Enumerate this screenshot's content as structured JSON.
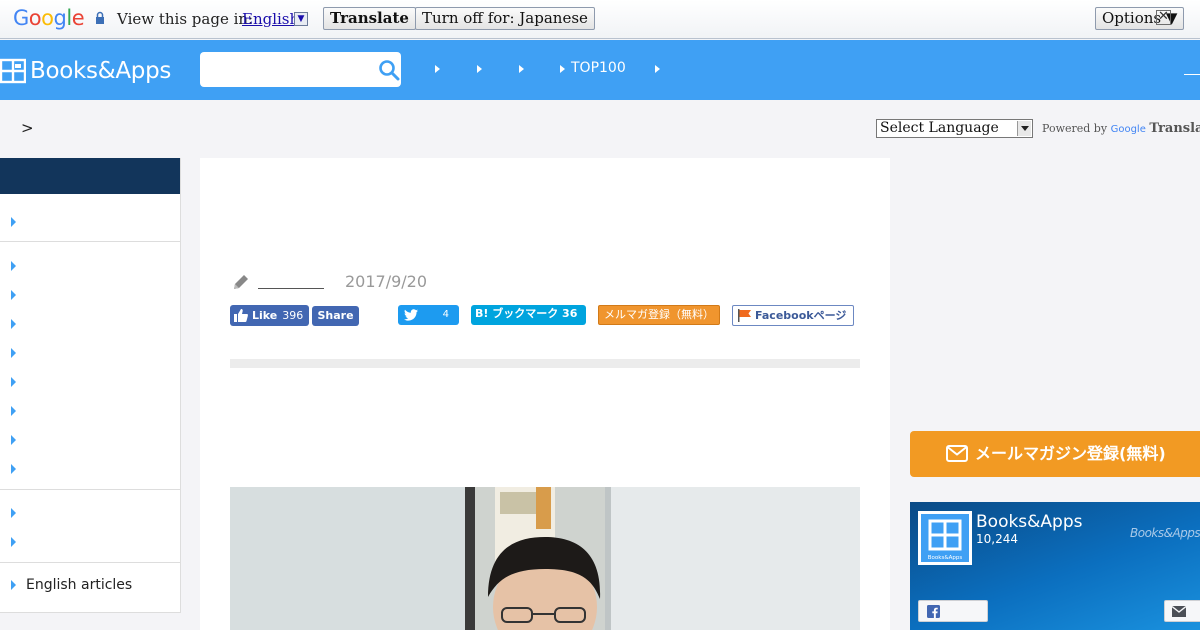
{
  "translate_bar": {
    "logo": "Google",
    "view_text": "View this page in:",
    "language": "English",
    "translate_label": "Translate",
    "turn_off_label": "Turn off for: Japanese",
    "options_label": "Options ▼",
    "close_label": "✕"
  },
  "header": {
    "brand": "Books&Apps",
    "search_placeholder": "",
    "nav_top100": "TOP100"
  },
  "breadcrumb": {
    "separator": ">"
  },
  "translate_widget": {
    "select_label": "Select Language",
    "powered_by": "Powered by",
    "google": "Google",
    "translate": "Translate"
  },
  "sidebar": {
    "last_item": "English articles"
  },
  "article": {
    "date": "2017/9/20",
    "fb_like_label": "Like",
    "fb_like_count": "396",
    "fb_share_label": "Share",
    "tweet_count": "4",
    "hatena_label": "B! ブックマーク 36",
    "mailmag_label": "メルマガ登録（無料）",
    "fb_page_label": "Facebookページ"
  },
  "right": {
    "mailmag_button": "メールマガジン登録(無料)",
    "fb_page_name": "Books&Apps",
    "fb_page_likes": "10,244",
    "fb_cover_text": "Books&Apps",
    "logo_caption": "Books&Apps"
  },
  "colors": {
    "header_blue": "#3fa0f4",
    "sidebar_navy": "#12355b",
    "accent_orange": "#f29a23"
  }
}
